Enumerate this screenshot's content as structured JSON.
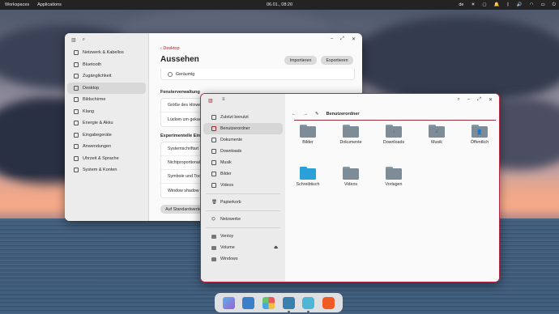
{
  "topbar": {
    "menu": [
      "Workspaces",
      "Applications"
    ],
    "clock": "06.01., 08:20",
    "keyboard_layout": "de"
  },
  "settings": {
    "sidebar": [
      {
        "label": "Netzwerk & Kabellos",
        "icon": "network-icon"
      },
      {
        "label": "Bluetooth",
        "icon": "bluetooth-icon"
      },
      {
        "label": "Zugänglichkeit",
        "icon": "accessibility-icon"
      },
      {
        "label": "Desktop",
        "icon": "desktop-icon",
        "active": true
      },
      {
        "label": "Bildschirme",
        "icon": "display-icon"
      },
      {
        "label": "Klang",
        "icon": "sound-icon"
      },
      {
        "label": "Energie & Akku",
        "icon": "battery-icon"
      },
      {
        "label": "Eingabegeräte",
        "icon": "keyboard-icon"
      },
      {
        "label": "Anwendungen",
        "icon": "apps-icon"
      },
      {
        "label": "Uhrzeit & Sprache",
        "icon": "clock-icon"
      },
      {
        "label": "System & Konten",
        "icon": "system-icon"
      }
    ],
    "back_label": "Desktop",
    "title": "Aussehen",
    "import_label": "Importieren",
    "export_label": "Exportieren",
    "density_option": "Geräumig",
    "section_window": "Fensterverwaltung",
    "window_rows": [
      "Größe des Hinwei",
      "Lücken um gekach"
    ],
    "section_experimental": "Experimentelle Einst",
    "experimental_rows": [
      "Systemschriftart",
      "Nichtproportional",
      "Symbole und Tool",
      "Window shadow a"
    ],
    "reset_label": "Auf Standardwerte"
  },
  "files": {
    "sidebar": [
      {
        "label": "Zuletzt benutzt",
        "icon": "recent-icon"
      },
      {
        "label": "Benutzerordner",
        "icon": "home-icon",
        "active": true
      },
      {
        "label": "Dokumente",
        "icon": "document-icon"
      },
      {
        "label": "Downloads",
        "icon": "download-icon"
      },
      {
        "label": "Musik",
        "icon": "music-icon"
      },
      {
        "label": "Bilder",
        "icon": "image-icon"
      },
      {
        "label": "Videos",
        "icon": "video-icon"
      }
    ],
    "sidebar_trash": "Papierkorb",
    "sidebar_network": "Netzwerke",
    "devices": [
      {
        "label": "Ventoy",
        "icon": "drive-icon"
      },
      {
        "label": "Volume",
        "icon": "drive-icon",
        "eject": true
      },
      {
        "label": "Windows",
        "icon": "drive-icon"
      }
    ],
    "path": "Benutzerordner",
    "folders": [
      {
        "label": "Bilder",
        "glyph": ""
      },
      {
        "label": "Dokumente",
        "glyph": ""
      },
      {
        "label": "Downloads",
        "glyph": "↓"
      },
      {
        "label": "Musik",
        "glyph": "♫"
      },
      {
        "label": "Öffentlich",
        "glyph": "👤"
      },
      {
        "label": "Schreibtisch",
        "glyph": "",
        "color": "#2a9fd8"
      },
      {
        "label": "Videos",
        "glyph": ""
      },
      {
        "label": "Vorlagen",
        "glyph": ""
      }
    ]
  },
  "colors": {
    "accent": "#9a2626",
    "files_border": "#b52b45"
  }
}
